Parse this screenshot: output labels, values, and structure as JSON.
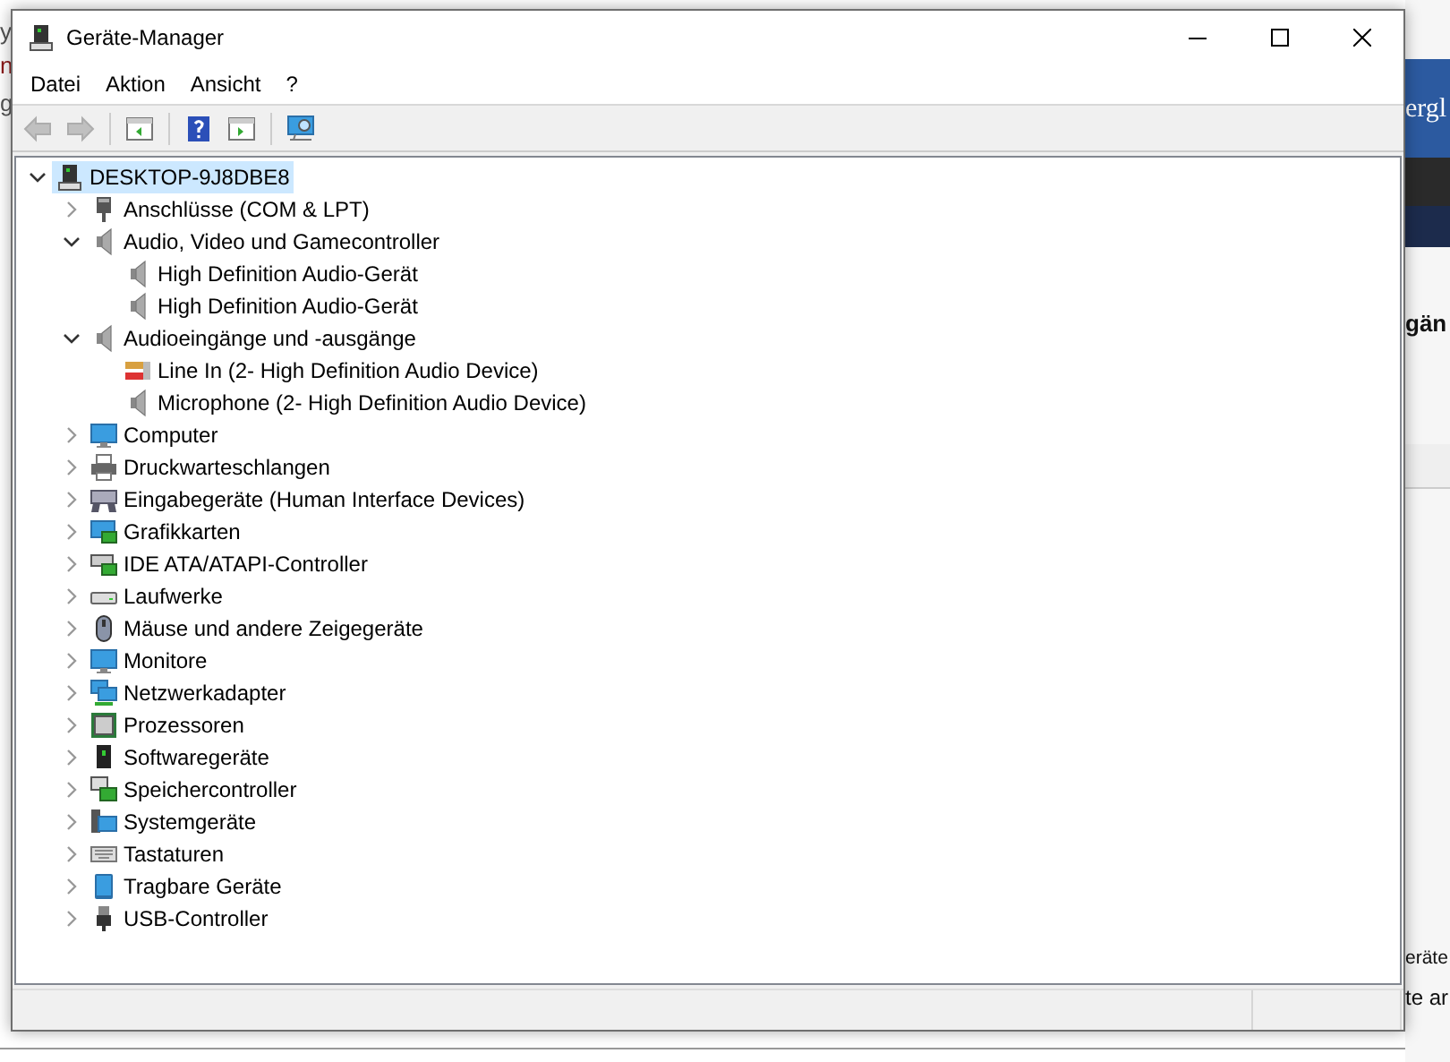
{
  "background": {
    "left_texts": [
      "y",
      "n",
      "g"
    ],
    "right_texts": [
      "ergl",
      "gän",
      "eräte",
      "te ar"
    ]
  },
  "window": {
    "title": "Geräte-Manager"
  },
  "menu": [
    "Datei",
    "Aktion",
    "Ansicht",
    "?"
  ],
  "toolbar": [
    {
      "kind": "back",
      "disabled": true
    },
    {
      "kind": "forward",
      "disabled": true
    },
    {
      "kind": "separator"
    },
    {
      "kind": "console",
      "disabled": false
    },
    {
      "kind": "separator"
    },
    {
      "kind": "help",
      "disabled": false
    },
    {
      "kind": "panel",
      "disabled": false
    },
    {
      "kind": "separator"
    },
    {
      "kind": "scan",
      "disabled": false
    }
  ],
  "tree": [
    {
      "label": "DESKTOP-9J8DBE8",
      "kind": "computer",
      "selected": true,
      "expanded": true,
      "children": [
        {
          "label": "Anschlüsse (COM & LPT)",
          "kind": "port",
          "selected": false,
          "expanded": false
        },
        {
          "label": "Audio, Video und Gamecontroller",
          "kind": "speaker",
          "selected": false,
          "expanded": true,
          "children": [
            {
              "label": "High Definition Audio-Gerät",
              "kind": "speaker",
              "selected": false
            },
            {
              "label": "High Definition Audio-Gerät",
              "kind": "speaker",
              "selected": false
            }
          ]
        },
        {
          "label": "Audioeingänge und -ausgänge",
          "kind": "speaker",
          "selected": false,
          "expanded": true,
          "children": [
            {
              "label": "Line In (2- High Definition Audio Device)",
              "kind": "plug",
              "selected": false
            },
            {
              "label": "Microphone (2- High Definition Audio Device)",
              "kind": "speaker",
              "selected": false
            }
          ]
        },
        {
          "label": "Computer",
          "kind": "monitor",
          "selected": false,
          "expanded": false
        },
        {
          "label": "Druckwarteschlangen",
          "kind": "printer",
          "selected": false,
          "expanded": false
        },
        {
          "label": "Eingabegeräte (Human Interface Devices)",
          "kind": "gamepad",
          "selected": false,
          "expanded": false
        },
        {
          "label": "Grafikkarten",
          "kind": "card",
          "selected": false,
          "expanded": false
        },
        {
          "label": "IDE ATA/ATAPI-Controller",
          "kind": "ide",
          "selected": false,
          "expanded": false
        },
        {
          "label": "Laufwerke",
          "kind": "drive",
          "selected": false,
          "expanded": false
        },
        {
          "label": "Mäuse und andere Zeigegeräte",
          "kind": "mouse",
          "selected": false,
          "expanded": false
        },
        {
          "label": "Monitore",
          "kind": "monitor",
          "selected": false,
          "expanded": false
        },
        {
          "label": "Netzwerkadapter",
          "kind": "network",
          "selected": false,
          "expanded": false
        },
        {
          "label": "Prozessoren",
          "kind": "cpu",
          "selected": false,
          "expanded": false
        },
        {
          "label": "Softwaregeräte",
          "kind": "software",
          "selected": false,
          "expanded": false
        },
        {
          "label": "Speichercontroller",
          "kind": "storage",
          "selected": false,
          "expanded": false
        },
        {
          "label": "Systemgeräte",
          "kind": "system",
          "selected": false,
          "expanded": false
        },
        {
          "label": "Tastaturen",
          "kind": "keyboard",
          "selected": false,
          "expanded": false
        },
        {
          "label": "Tragbare Geräte",
          "kind": "portable",
          "selected": false,
          "expanded": false
        },
        {
          "label": "USB-Controller",
          "kind": "usb",
          "selected": false,
          "expanded": false
        }
      ]
    }
  ]
}
